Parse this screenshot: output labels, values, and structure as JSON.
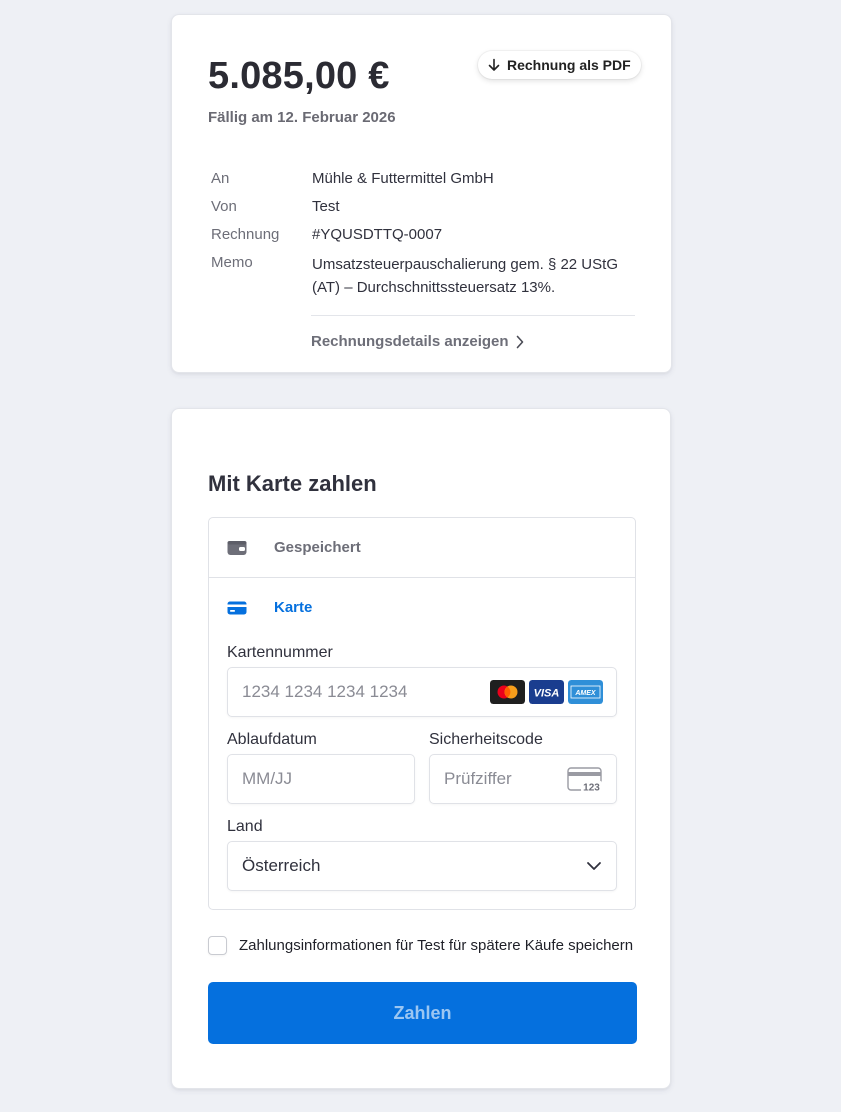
{
  "invoice": {
    "amount": "5.085,00 €",
    "due": "Fällig am 12. Februar 2026",
    "pdf_button": "Rechnung als PDF",
    "to_label": "An",
    "to_value": "Mühle & Futtermittel GmbH",
    "from_label": "Von",
    "from_value": "Test",
    "invoice_label": "Rechnung",
    "invoice_value": "#YQUSDTTQ-0007",
    "memo_label": "Memo",
    "memo_value": "Umsatzsteuerpauschalierung gem. § 22 UStG (AT) – Durchschnittssteuersatz 13%.",
    "details_link": "Rechnungsdetails anzeigen"
  },
  "payment": {
    "title": "Mit Karte zahlen",
    "method_saved": "Gespeichert",
    "method_card": "Karte",
    "card_number_label": "Kartennummer",
    "card_number_placeholder": "1234 1234 1234 1234",
    "expiry_label": "Ablaufdatum",
    "expiry_placeholder": "MM/JJ",
    "cvc_label": "Sicherheitscode",
    "cvc_placeholder": "Prüfziffer",
    "cvc_icon_text": "123",
    "country_label": "Land",
    "country_value": "Österreich",
    "save_info": "Zahlungsinformationen für Test für spätere Käufe speichern",
    "pay_button": "Zahlen",
    "brands": {
      "visa": "VISA",
      "amex": "AMEX"
    }
  },
  "icons": [
    "arrow-down-icon",
    "chevron-right-icon",
    "wallet-icon",
    "credit-card-icon",
    "mastercard-icon",
    "visa-icon",
    "amex-icon",
    "cvc-card-icon",
    "chevron-down-icon"
  ],
  "colors": {
    "accent": "#0570de",
    "background": "#eef0f5",
    "text": "#30313d",
    "muted": "#6d6e78"
  }
}
